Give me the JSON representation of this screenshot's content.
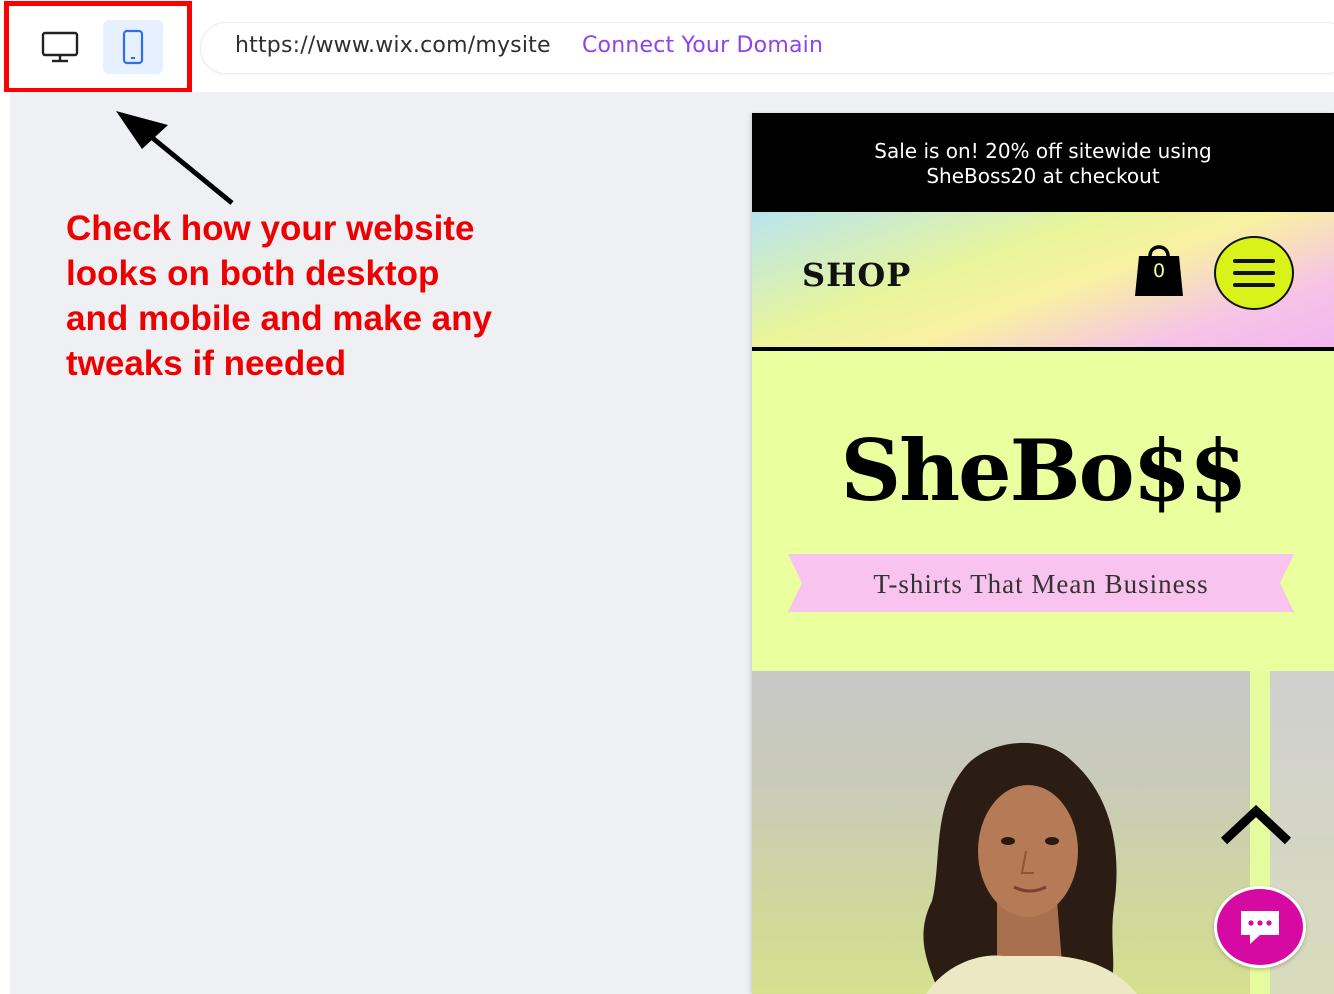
{
  "toolbar": {
    "device_modes": [
      "desktop",
      "mobile"
    ],
    "active_mode": "mobile",
    "url": "https://www.wix.com/mysite",
    "connect_label": "Connect Your Domain"
  },
  "annotation": {
    "text": "Check how your website looks on both desktop and mobile and make any tweaks if needed",
    "color": "#ee0000"
  },
  "preview": {
    "promo_line1": "Sale is on! 20% off sitewide using",
    "promo_line2": "SheBoss20 at checkout",
    "shop_label": "SHOP",
    "cart_count": "0",
    "brand": "SheBo$$",
    "tagline": "T-shirts That Mean Business",
    "colors": {
      "lime": "#eaff9d",
      "pink": "#f8c3ee",
      "chat": "#d60aa3",
      "link": "#8f43ee"
    },
    "icons": [
      "desktop-icon",
      "mobile-icon",
      "shopping-bag-icon",
      "hamburger-menu-icon",
      "chevron-up-icon",
      "chat-icon"
    ]
  }
}
